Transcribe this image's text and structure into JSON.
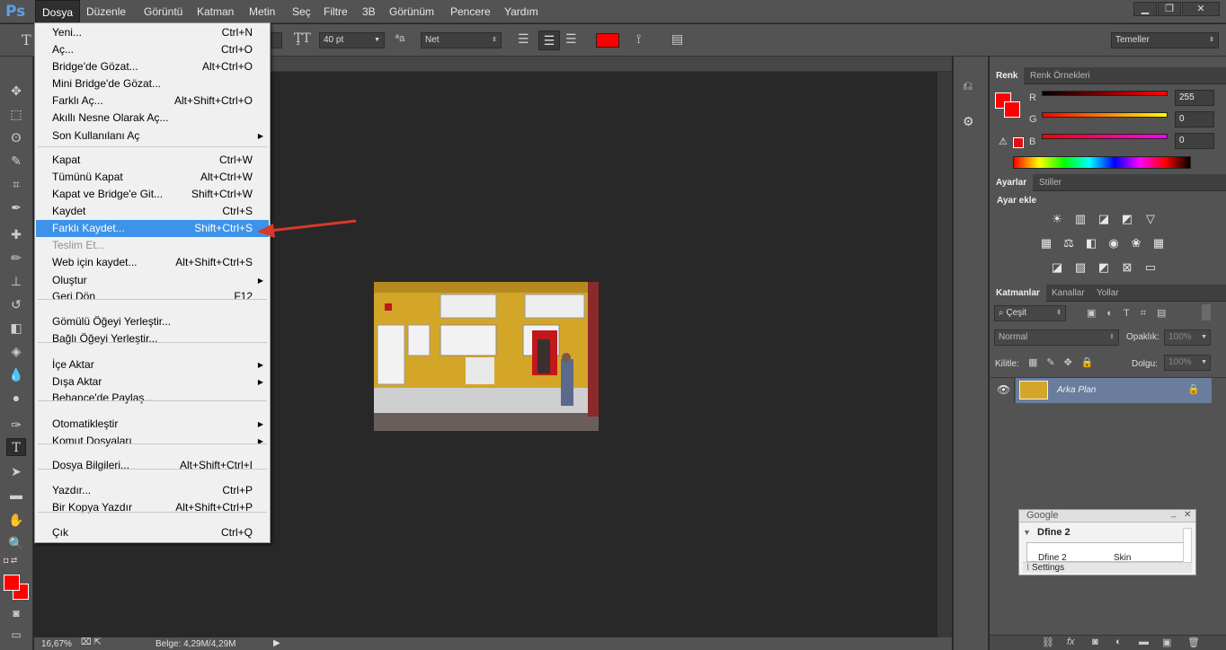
{
  "app": {
    "logo": "Ps"
  },
  "menubar": {
    "items": [
      "Dosya",
      "Düzenle",
      "Görüntü",
      "Katman",
      "Metin",
      "Seç",
      "Filtre",
      "3B",
      "Görünüm",
      "Pencere",
      "Yardım"
    ]
  },
  "options_bar": {
    "font_size": "40 pt",
    "antialias": "Net",
    "text_color": "#ff0000",
    "workspace": "Temeller"
  },
  "file_menu": {
    "items": [
      {
        "label": "Yeni...",
        "shortcut": "Ctrl+N"
      },
      {
        "label": "Aç...",
        "shortcut": "Ctrl+O"
      },
      {
        "label": "Bridge'de Gözat...",
        "shortcut": "Alt+Ctrl+O"
      },
      {
        "label": "Mini Bridge'de Gözat...",
        "shortcut": ""
      },
      {
        "label": "Farklı Aç...",
        "shortcut": "Alt+Shift+Ctrl+O"
      },
      {
        "label": "Akıllı Nesne Olarak Aç...",
        "shortcut": ""
      },
      {
        "label": "Son Kullanılanı Aç",
        "shortcut": "",
        "submenu": true
      },
      {
        "label": "Kapat",
        "shortcut": "Ctrl+W"
      },
      {
        "label": "Tümünü Kapat",
        "shortcut": "Alt+Ctrl+W"
      },
      {
        "label": "Kapat ve Bridge'e Git...",
        "shortcut": "Shift+Ctrl+W"
      },
      {
        "label": "Kaydet",
        "shortcut": "Ctrl+S"
      },
      {
        "label": "Farklı Kaydet...",
        "shortcut": "Shift+Ctrl+S",
        "highlighted": true
      },
      {
        "label": "Teslim Et...",
        "shortcut": "",
        "disabled": true
      },
      {
        "label": "Web için kaydet...",
        "shortcut": "Alt+Shift+Ctrl+S"
      },
      {
        "label": "Oluştur",
        "shortcut": "",
        "submenu": true
      },
      {
        "label": "Geri Dön",
        "shortcut": "F12"
      },
      {
        "label": "Gömülü Öğeyi Yerleştir...",
        "shortcut": ""
      },
      {
        "label": "Bağlı Öğeyi Yerleştir...",
        "shortcut": ""
      },
      {
        "label": "İçe Aktar",
        "shortcut": "",
        "submenu": true
      },
      {
        "label": "Dışa Aktar",
        "shortcut": "",
        "submenu": true
      },
      {
        "label": "Behance'de Paylaş...",
        "shortcut": ""
      },
      {
        "label": "Otomatikleştir",
        "shortcut": "",
        "submenu": true
      },
      {
        "label": "Komut Dosyaları",
        "shortcut": "",
        "submenu": true
      },
      {
        "label": "Dosya Bilgileri...",
        "shortcut": "Alt+Shift+Ctrl+I"
      },
      {
        "label": "Yazdır...",
        "shortcut": "Ctrl+P"
      },
      {
        "label": "Bir Kopya Yazdır",
        "shortcut": "Alt+Shift+Ctrl+P"
      },
      {
        "label": "Çık",
        "shortcut": "Ctrl+Q"
      }
    ]
  },
  "status": {
    "zoom": "16,67%",
    "doc": "Belge: 4,29M/4,29M"
  },
  "color_panel": {
    "tabs": [
      "Renk",
      "Renk Örnekleri"
    ],
    "channels": [
      {
        "label": "R",
        "value": "255"
      },
      {
        "label": "G",
        "value": "0"
      },
      {
        "label": "B",
        "value": "0"
      }
    ],
    "foreground": "#ff0000"
  },
  "adjustments_panel": {
    "tabs": [
      "Ayarlar",
      "Stiller"
    ],
    "title": "Ayar ekle"
  },
  "layers_panel": {
    "tabs": [
      "Katmanlar",
      "Kanallar",
      "Yollar"
    ],
    "filter_kind": "Çeşit",
    "blend_mode": "Normal",
    "opacity_label": "Opaklık:",
    "opacity_value": "100%",
    "lock_label": "Kilitle:",
    "fill_label": "Dolgu:",
    "fill_value": "100%",
    "layers": [
      {
        "name": "Arka Plan",
        "locked": true,
        "visible": true
      }
    ]
  },
  "google_panel": {
    "title": "Google",
    "plugin": "Dfine 2",
    "col1": "Dfine 2",
    "col2": "Skin",
    "settings": "Settings"
  }
}
